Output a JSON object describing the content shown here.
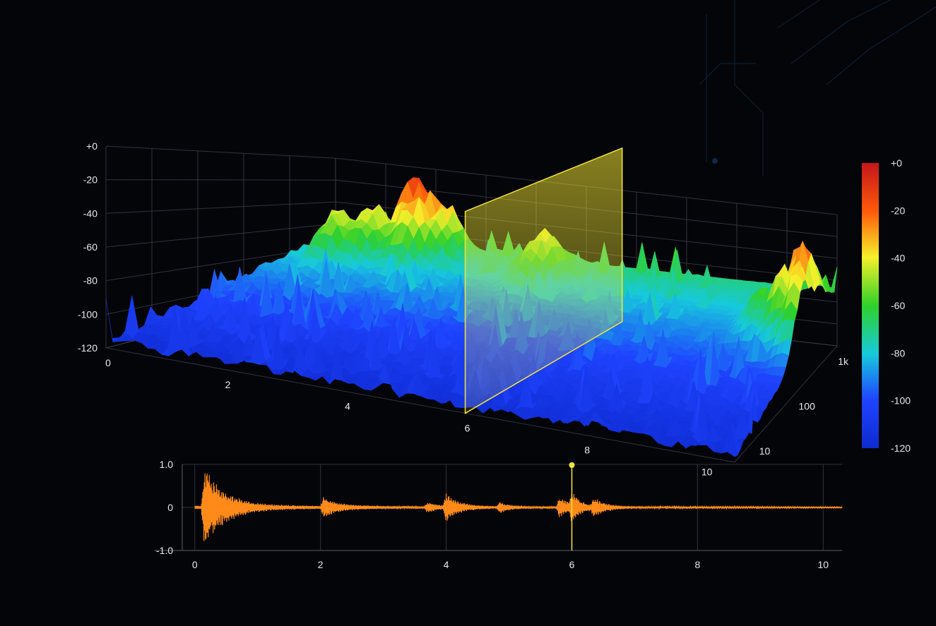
{
  "chart_data": [
    {
      "type": "surface",
      "title": "",
      "xlabel": "",
      "ylabel": "",
      "zlabel": "",
      "x_ticks": [
        "0",
        "2",
        "4",
        "6",
        "8",
        "10"
      ],
      "y_ticks": [
        "10",
        "100",
        "1k"
      ],
      "y_scale": "log",
      "z_ticks": [
        "+0",
        "-20",
        "-40",
        "-60",
        "-80",
        "-100",
        "-120"
      ],
      "xlim": [
        0,
        10.5
      ],
      "ylim": [
        5,
        2000
      ],
      "zlim": [
        -120,
        0
      ],
      "peaks": [
        {
          "x": 1.9,
          "y": 1500,
          "z": -5
        },
        {
          "x": 2.1,
          "y": 1300,
          "z": -10
        },
        {
          "x": 2.4,
          "y": 1800,
          "z": -25
        },
        {
          "x": 0.9,
          "y": 700,
          "z": -35
        },
        {
          "x": 1.3,
          "y": 1000,
          "z": -30
        },
        {
          "x": 4.8,
          "y": 900,
          "z": -35
        },
        {
          "x": 4.6,
          "y": 1100,
          "z": -45
        },
        {
          "x": 10.2,
          "y": 600,
          "z": -5
        },
        {
          "x": 10.0,
          "y": 400,
          "z": -30
        },
        {
          "x": 10.4,
          "y": 300,
          "z": -25
        },
        {
          "x": 9.5,
          "y": 500,
          "z": -55
        }
      ],
      "slice_marker": {
        "x": 6.0,
        "color": "#f5e63a"
      }
    },
    {
      "type": "colorbar",
      "ticks": [
        "+0",
        "-20",
        "-40",
        "-60",
        "-80",
        "-100",
        "-120"
      ],
      "range": [
        -120,
        0
      ],
      "colors": [
        "#d41a1a",
        "#ff6a00",
        "#f5f02a",
        "#2fd02a",
        "#1ad0d8",
        "#1f4cff",
        "#1030d8"
      ]
    },
    {
      "type": "line",
      "x_ticks": [
        "0",
        "2",
        "4",
        "6",
        "8",
        "10"
      ],
      "y_ticks": [
        "1.0",
        "0",
        "-1.0"
      ],
      "xlim": [
        -0.2,
        10.3
      ],
      "ylim": [
        -1.0,
        1.0
      ],
      "color": "#ff8a1a",
      "cursor": {
        "x": 6.0,
        "color": "#f5e63a"
      },
      "bursts": [
        {
          "t": 0.15,
          "amp": 0.9,
          "decay": 0.35
        },
        {
          "t": 2.05,
          "amp": 0.22,
          "decay": 0.25
        },
        {
          "t": 3.7,
          "amp": 0.12,
          "decay": 0.15
        },
        {
          "t": 4.0,
          "amp": 0.32,
          "decay": 0.2
        },
        {
          "t": 4.85,
          "amp": 0.12,
          "decay": 0.15
        },
        {
          "t": 5.8,
          "amp": 0.22,
          "decay": 0.2
        },
        {
          "t": 6.0,
          "amp": 0.3,
          "decay": 0.15
        },
        {
          "t": 6.35,
          "amp": 0.18,
          "decay": 0.2
        }
      ],
      "noise_floor": 0.04
    }
  ]
}
